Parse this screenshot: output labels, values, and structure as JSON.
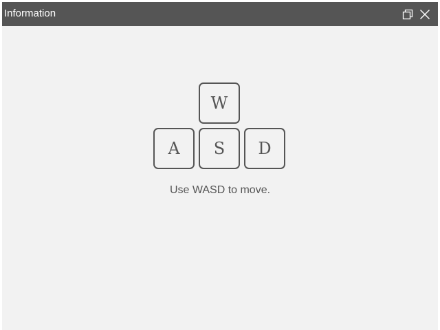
{
  "window": {
    "title": "Information"
  },
  "icons": {
    "restore": "restore-icon",
    "close": "close-icon"
  },
  "keys": {
    "up": "W",
    "left": "A",
    "down": "S",
    "right": "D"
  },
  "instruction": "Use WASD to move.",
  "colors": {
    "titlebar": "#555555",
    "background": "#f2f2f2",
    "key_border": "#555555",
    "text": "#555555"
  }
}
